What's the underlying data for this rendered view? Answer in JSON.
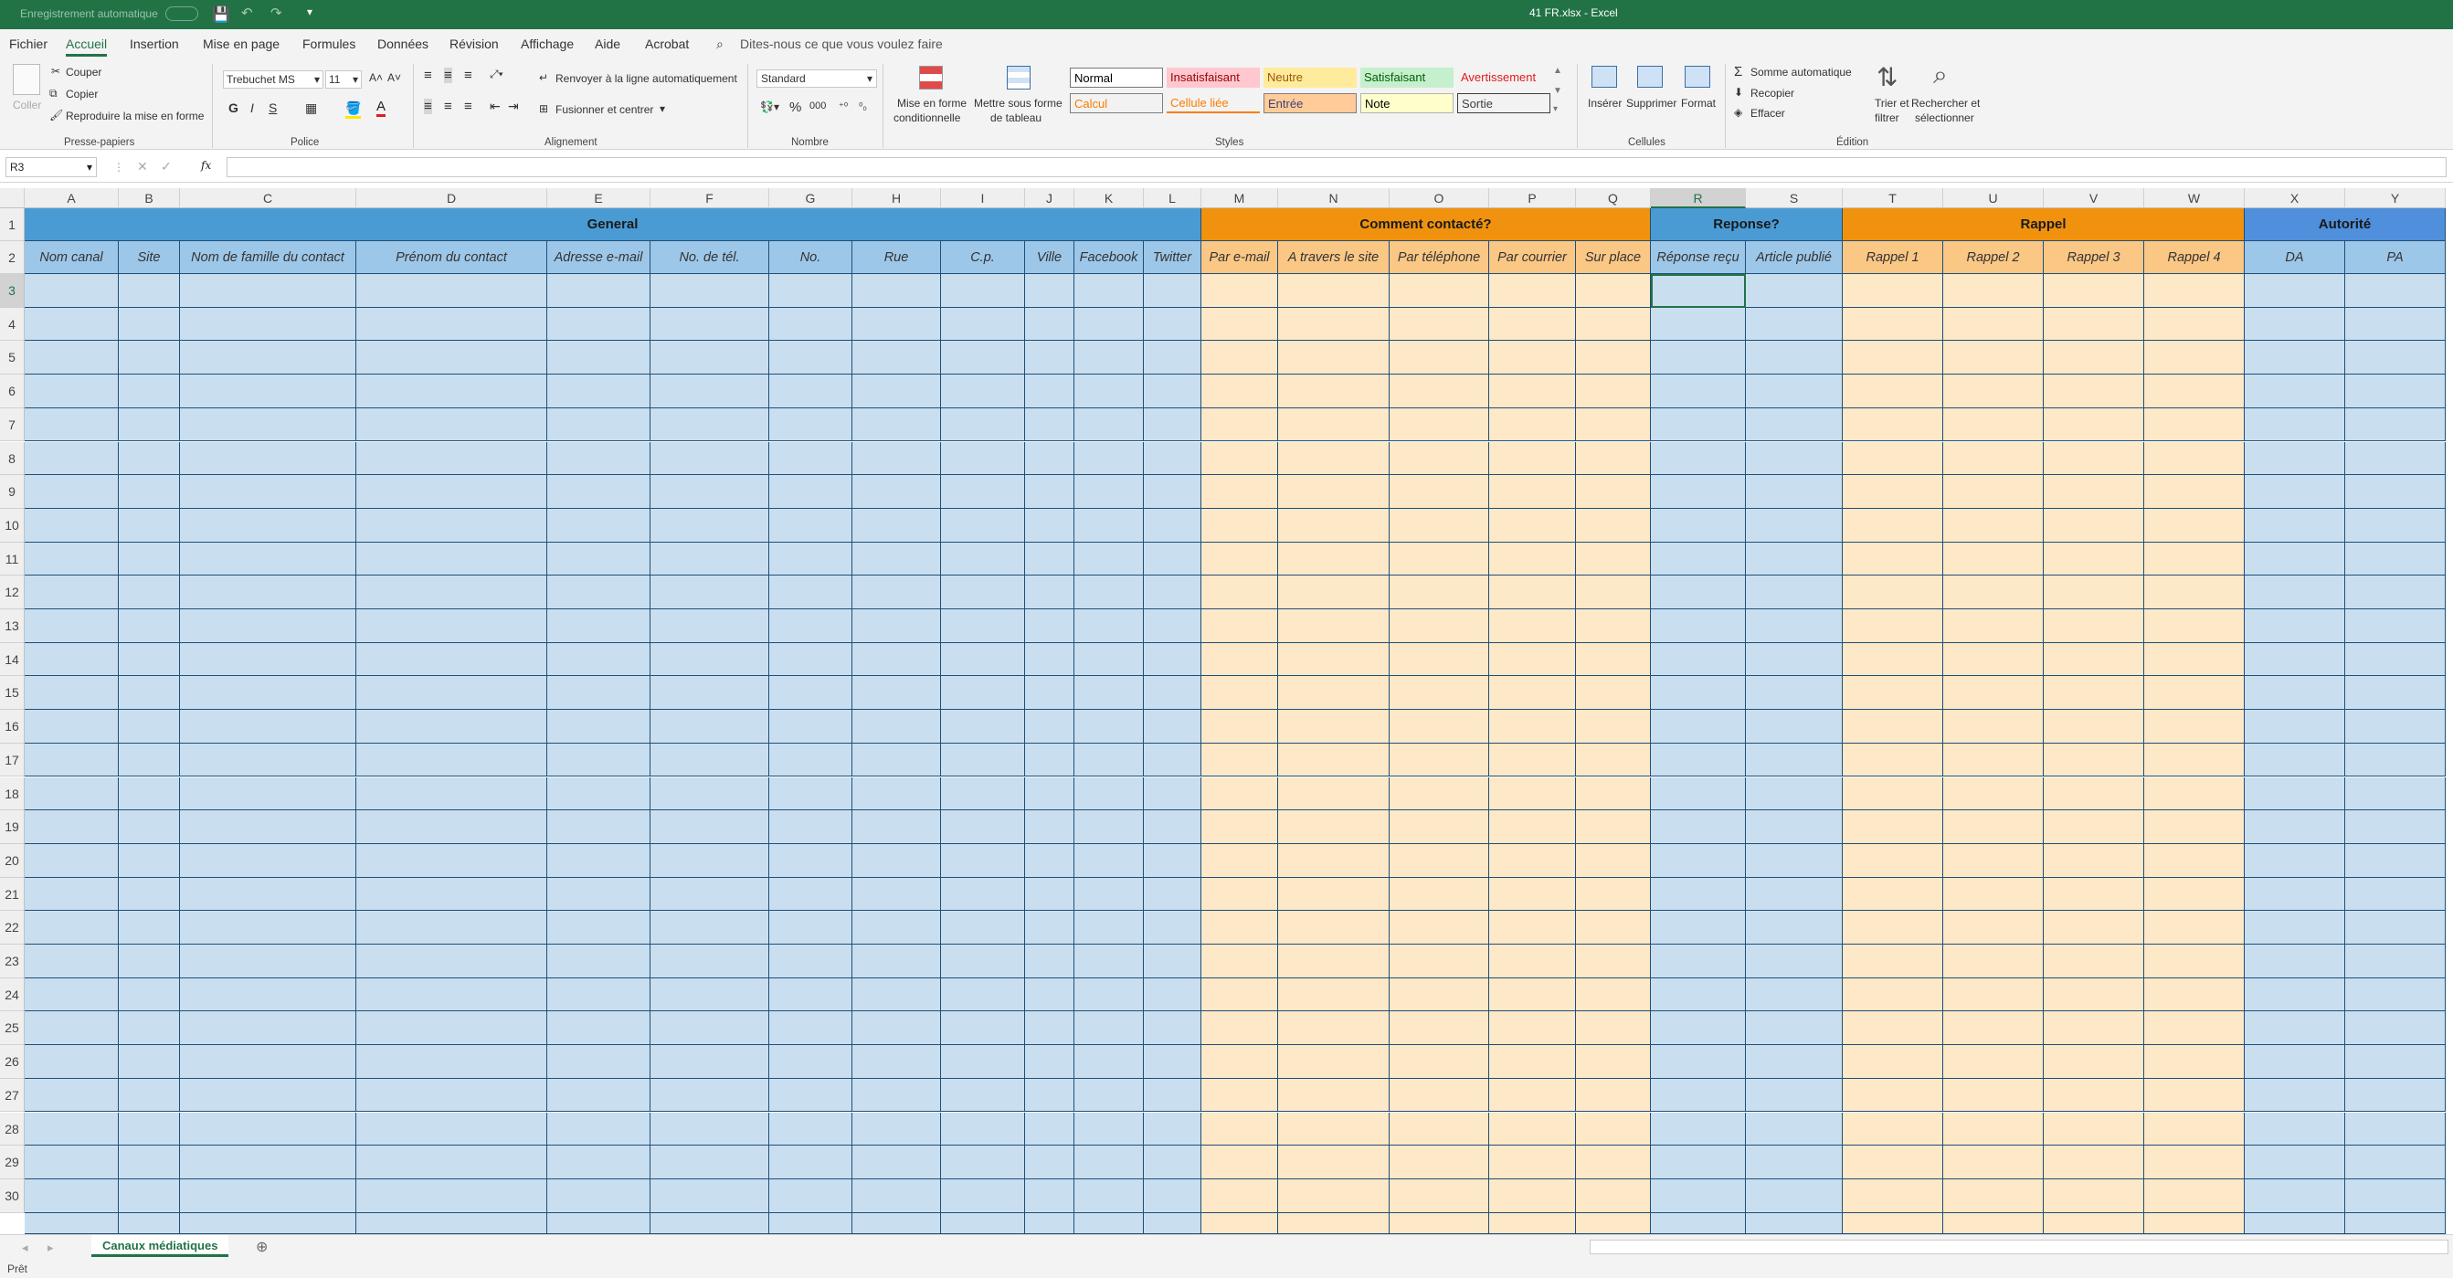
{
  "titlebar": {
    "autosave": "Enregistrement automatique",
    "title": "41 FR.xlsx  -  Excel"
  },
  "menu": [
    "Fichier",
    "Accueil",
    "Insertion",
    "Mise en page",
    "Formules",
    "Données",
    "Révision",
    "Affichage",
    "Aide",
    "Acrobat"
  ],
  "menu_active": "Accueil",
  "tell_me": "Dites-nous ce que vous voulez faire",
  "ribbon": {
    "paste": "Coller",
    "cut": "Couper",
    "copy": "Copier",
    "format_painter": "Reproduire la mise en forme",
    "clipboard_group": "Presse-papiers",
    "font_name": "Trebuchet MS",
    "font_size": "11",
    "bold": "G",
    "italic": "I",
    "underline": "S",
    "font_group": "Police",
    "wrap": "Renvoyer à la ligne automatiquement",
    "merge": "Fusionner et centrer",
    "align_group": "Alignement",
    "number_format": "Standard",
    "number_group": "Nombre",
    "cond_format_1": "Mise en forme",
    "cond_format_2": "conditionnelle",
    "table_format_1": "Mettre sous forme",
    "table_format_2": "de tableau",
    "styles": [
      "Normal",
      "Insatisfaisant",
      "Neutre",
      "Satisfaisant",
      "Avertissement",
      "Calcul",
      "Cellule liée",
      "Entrée",
      "Note",
      "Sortie"
    ],
    "styles_group": "Styles",
    "insert": "Insérer",
    "delete": "Supprimer",
    "format": "Format",
    "cells_group": "Cellules",
    "autosum": "Somme automatique",
    "fill": "Recopier",
    "clear": "Effacer",
    "sort_1": "Trier et",
    "sort_2": "filtrer",
    "find_1": "Rechercher et",
    "find_2": "sélectionner",
    "edit_group": "Édition"
  },
  "formula_bar": {
    "name_box": "R3",
    "formula": ""
  },
  "columns": [
    "A",
    "B",
    "C",
    "D",
    "E",
    "F",
    "G",
    "H",
    "I",
    "J",
    "K",
    "L",
    "M",
    "N",
    "O",
    "P",
    "Q",
    "R",
    "S",
    "T",
    "U",
    "V",
    "W",
    "X",
    "Y"
  ],
  "selected_cell": "R3",
  "groups": [
    {
      "label": "General",
      "color": "#4a9bd4"
    },
    {
      "label": "Comment contacté?",
      "color": "#f0920e"
    },
    {
      "label": "Reponse?",
      "color": "#4a9bd4"
    },
    {
      "label": "Rappel",
      "color": "#f0920e"
    },
    {
      "label": "Autorité",
      "color": "#4f8fdb"
    }
  ],
  "subheaders": [
    "Nom canal",
    "Site",
    "Nom de famille du contact",
    "Prénom du contact",
    "Adresse e-mail",
    "No. de tél.",
    "No.",
    "Rue",
    "C.p.",
    "Ville",
    "Facebook",
    "Twitter",
    "Par e-mail",
    "A travers le site",
    "Par téléphone",
    "Par courrier",
    "Sur place",
    "Réponse reçu",
    "Article publié",
    "Rappel 1",
    "Rappel 2",
    "Rappel 3",
    "Rappel 4",
    "DA",
    "PA"
  ],
  "rows": [
    "1",
    "2",
    "3",
    "4",
    "5",
    "6",
    "7",
    "8",
    "9",
    "10",
    "11",
    "12",
    "13",
    "14",
    "15",
    "16",
    "17",
    "18",
    "19",
    "20",
    "21",
    "22",
    "23",
    "24",
    "25",
    "26",
    "27",
    "28",
    "29",
    "30"
  ],
  "sheet_tab": "Canaux médiatiques",
  "status": "Prêt"
}
